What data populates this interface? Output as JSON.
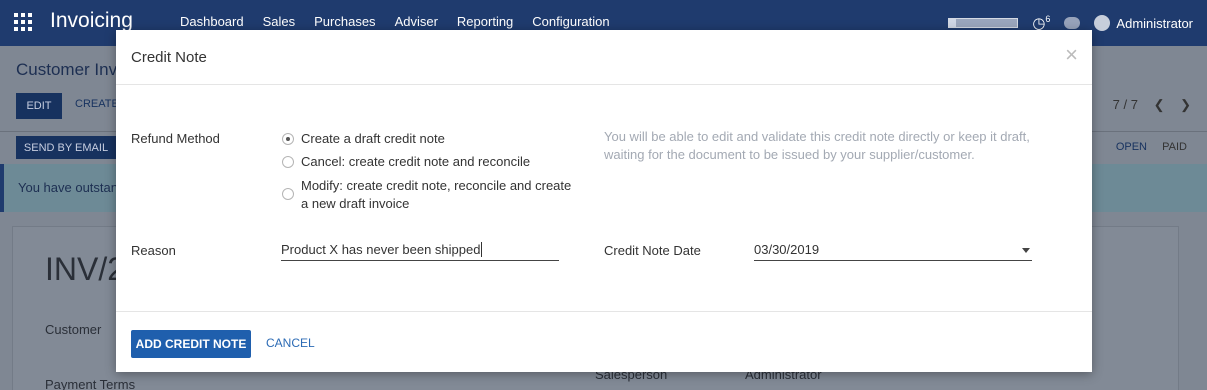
{
  "navbar": {
    "app_title": "Invoicing",
    "menu": [
      "Dashboard",
      "Sales",
      "Purchases",
      "Adviser",
      "Reporting",
      "Configuration"
    ],
    "activity_count": "6",
    "user": "Administrator",
    "icons": [
      "apps-icon",
      "activity-clock-icon",
      "chat-icon",
      "avatar"
    ]
  },
  "background": {
    "breadcrumb": "Customer Inv",
    "edit_label": "EDIT",
    "create_label": "CREATE",
    "pager": "7 / 7",
    "send_by_email": "SEND BY EMAIL",
    "status_open": "OPEN",
    "status_paid": "PAID",
    "alert_text": "You have outstanc",
    "invoice_title": "INV/2",
    "customer_label": "Customer",
    "payment_terms_label": "Payment Terms",
    "salesperson_label": "Salesperson",
    "salesperson_value": "Administrator"
  },
  "dialog": {
    "title": "Credit Note",
    "close_symbol": "×",
    "refund_method_label": "Refund Method",
    "options": [
      {
        "label": "Create a draft credit note",
        "checked": true
      },
      {
        "label": "Cancel: create credit note and reconcile",
        "checked": false
      },
      {
        "label_line1": "Modify: create credit note, reconcile and create",
        "label_line2": "a new draft invoice",
        "checked": false
      }
    ],
    "help_text": "You will be able to edit and validate this credit note directly or keep it draft, waiting for the document to be issued by your supplier/customer.",
    "reason_label": "Reason",
    "reason_value": "Product X has never been shipped",
    "credit_note_date_label": "Credit Note Date",
    "credit_note_date_value": "03/30/2019",
    "add_button": "ADD CREDIT NOTE",
    "cancel_button": "CANCEL",
    "accent_color": "#1f5fad"
  }
}
